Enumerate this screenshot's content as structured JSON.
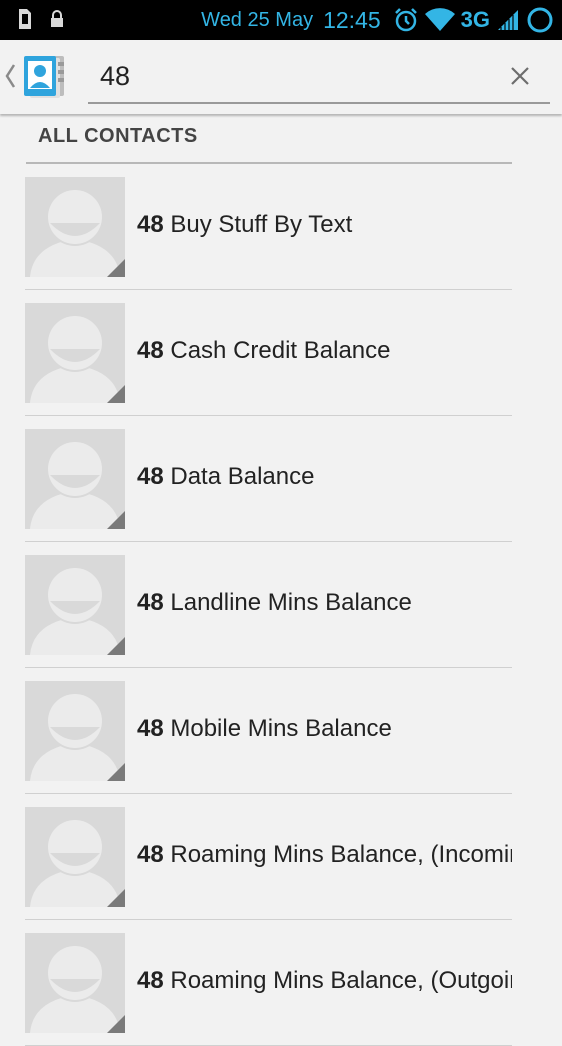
{
  "status_bar": {
    "date": "Wed 25 May",
    "time": "12:45",
    "network": "3G"
  },
  "search": {
    "query": "48",
    "placeholder": ""
  },
  "section": {
    "title": "ALL CONTACTS"
  },
  "contacts": [
    {
      "match": "48",
      "rest": " Buy Stuff By Text"
    },
    {
      "match": "48",
      "rest": " Cash Credit Balance"
    },
    {
      "match": "48",
      "rest": " Data Balance"
    },
    {
      "match": "48",
      "rest": " Landline Mins Balance"
    },
    {
      "match": "48",
      "rest": " Mobile Mins Balance"
    },
    {
      "match": "48",
      "rest": " Roaming Mins Balance, (Incoming)"
    },
    {
      "match": "48",
      "rest": " Roaming Mins Balance, (Outgoing)"
    }
  ],
  "colors": {
    "accent": "#33b5e5",
    "status_bar_bg": "#000000",
    "background": "#f2f2f2",
    "avatar_bg": "#d9d9d9"
  },
  "icons": {
    "sim": "sim-card-icon",
    "lock": "lock-icon",
    "alarm": "alarm-icon",
    "wifi": "wifi-icon",
    "signal": "signal-icon",
    "battery": "battery-icon",
    "app": "contacts-app-icon",
    "clear": "close-icon",
    "avatar": "default-contact-avatar-icon"
  }
}
